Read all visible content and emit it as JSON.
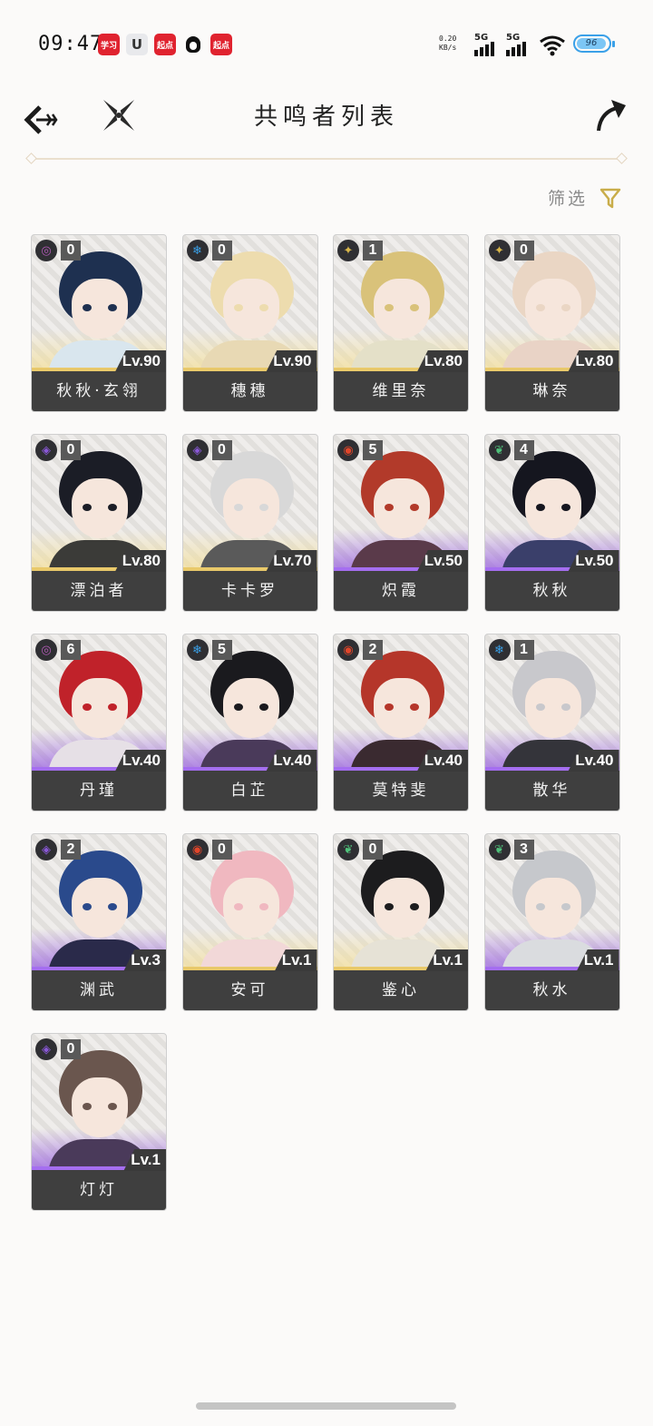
{
  "status_bar": {
    "time": "09:47",
    "notifications": [
      "学习",
      "U",
      "起点",
      "QQ",
      "起点"
    ],
    "net_speed_value": "0.20",
    "net_speed_unit": "KB/s",
    "sim1": "5G",
    "sim2": "5G",
    "battery": "96"
  },
  "header": {
    "title": "共鸣者列表"
  },
  "filter": {
    "label": "筛选"
  },
  "colors": {
    "fire": "#e0452a",
    "ice": "#3aa0e8",
    "light": "#d8b64a",
    "dark": "#8a58d8",
    "wind": "#4fc07a",
    "electric": "#b45ab8",
    "gold_glow": "#f3df9a",
    "purple_glow": "#9a62e0"
  },
  "resonators": [
    {
      "name": "秋秋·玄翎",
      "level": "Lv.90",
      "chain": "0",
      "element": "electric",
      "rarity": "gold",
      "hair": "#1e3050",
      "body": "#d9e6ee"
    },
    {
      "name": "穗穗",
      "level": "Lv.90",
      "chain": "0",
      "element": "ice",
      "rarity": "gold",
      "hair": "#eddcae",
      "body": "#e8d9b4"
    },
    {
      "name": "维里奈",
      "level": "Lv.80",
      "chain": "1",
      "element": "light",
      "rarity": "gold",
      "hair": "#d9c27a",
      "body": "#e4e0c8"
    },
    {
      "name": "琳奈",
      "level": "Lv.80",
      "chain": "0",
      "element": "light",
      "rarity": "gold",
      "hair": "#ead6c4",
      "body": "#e9d3c6"
    },
    {
      "name": "漂泊者",
      "level": "Lv.80",
      "chain": "0",
      "element": "dark",
      "rarity": "gold",
      "hair": "#1b1d26",
      "body": "#3b3b38"
    },
    {
      "name": "卡卡罗",
      "level": "Lv.70",
      "chain": "0",
      "element": "dark",
      "rarity": "gold",
      "hair": "#d8d8d8",
      "body": "#5a5a5a"
    },
    {
      "name": "炽霞",
      "level": "Lv.50",
      "chain": "5",
      "element": "fire",
      "rarity": "purple",
      "hair": "#b23a2a",
      "body": "#5a3a4a"
    },
    {
      "name": "秋秋",
      "level": "Lv.50",
      "chain": "4",
      "element": "wind",
      "rarity": "purple",
      "hair": "#15161f",
      "body": "#3a3f6a"
    },
    {
      "name": "丹瑾",
      "level": "Lv.40",
      "chain": "6",
      "element": "electric",
      "rarity": "purple",
      "hair": "#c0222a",
      "body": "#e6e0e6"
    },
    {
      "name": "白芷",
      "level": "Lv.40",
      "chain": "5",
      "element": "ice",
      "rarity": "purple",
      "hair": "#1a1a1e",
      "body": "#4a3a5a"
    },
    {
      "name": "莫特斐",
      "level": "Lv.40",
      "chain": "2",
      "element": "fire",
      "rarity": "purple",
      "hair": "#b5362a",
      "body": "#3a2a30"
    },
    {
      "name": "散华",
      "level": "Lv.40",
      "chain": "1",
      "element": "ice",
      "rarity": "purple",
      "hair": "#c8c8cc",
      "body": "#34343a"
    },
    {
      "name": "渊武",
      "level": "Lv.3",
      "chain": "2",
      "element": "dark",
      "rarity": "purple",
      "hair": "#2a4a8c",
      "body": "#2a2a4a"
    },
    {
      "name": "安可",
      "level": "Lv.1",
      "chain": "0",
      "element": "fire",
      "rarity": "gold",
      "hair": "#f0b8c0",
      "body": "#f2d8d8"
    },
    {
      "name": "鉴心",
      "level": "Lv.1",
      "chain": "0",
      "element": "wind",
      "rarity": "gold",
      "hair": "#1c1c1e",
      "body": "#e6e2d6"
    },
    {
      "name": "秋水",
      "level": "Lv.1",
      "chain": "3",
      "element": "wind",
      "rarity": "purple",
      "hair": "#c6c8cc",
      "body": "#dadcdf"
    },
    {
      "name": "灯灯",
      "level": "Lv.1",
      "chain": "0",
      "element": "dark",
      "rarity": "purple",
      "hair": "#6a564e",
      "body": "#4a3a5a"
    }
  ]
}
